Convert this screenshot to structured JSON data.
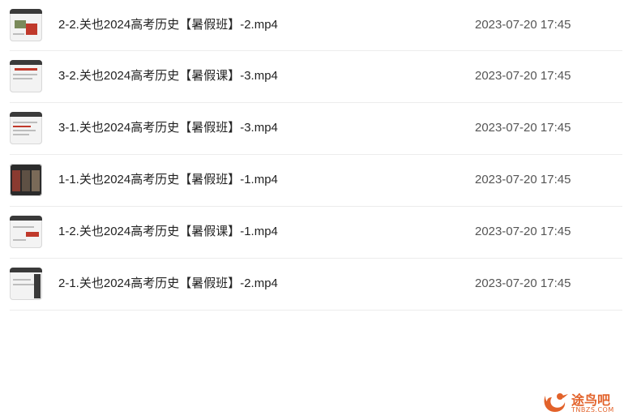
{
  "files": [
    {
      "name": "2-2.关也2024高考历史【暑假班】-2.mp4",
      "date": "2023-07-20 17:45",
      "icon": "video-thumbnail-icon"
    },
    {
      "name": "3-2.关也2024高考历史【暑假课】-3.mp4",
      "date": "2023-07-20 17:45",
      "icon": "video-thumbnail-icon"
    },
    {
      "name": "3-1.关也2024高考历史【暑假班】-3.mp4",
      "date": "2023-07-20 17:45",
      "icon": "video-thumbnail-icon"
    },
    {
      "name": "1-1.关也2024高考历史【暑假班】-1.mp4",
      "date": "2023-07-20 17:45",
      "icon": "video-thumbnail-icon"
    },
    {
      "name": "1-2.关也2024高考历史【暑假课】-1.mp4",
      "date": "2023-07-20 17:45",
      "icon": "video-thumbnail-icon"
    },
    {
      "name": "2-1.关也2024高考历史【暑假班】-2.mp4",
      "date": "2023-07-20 17:45",
      "icon": "video-thumbnail-icon"
    }
  ],
  "watermark": {
    "title": "途鸟吧",
    "subtitle": "TNBZS.COM",
    "color": "#e2622a"
  }
}
